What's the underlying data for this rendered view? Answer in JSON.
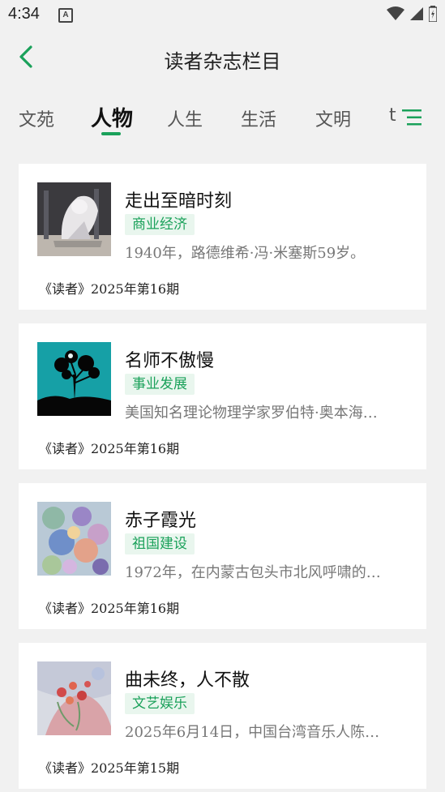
{
  "status_bar": {
    "time": "4:34"
  },
  "header": {
    "title": "读者杂志栏目"
  },
  "tabs": [
    {
      "label": "文苑",
      "active": false
    },
    {
      "label": "人物",
      "active": true
    },
    {
      "label": "人生",
      "active": false
    },
    {
      "label": "生活",
      "active": false
    },
    {
      "label": "文明",
      "active": false
    },
    {
      "label": "t",
      "active": false
    }
  ],
  "accent_color": "#1aa15a",
  "articles": [
    {
      "title": "走出至暗时刻",
      "tag": "商业经济",
      "desc": "1940年，路德维希·冯·米塞斯59岁。",
      "source": "《读者》2025年第16期"
    },
    {
      "title": "名师不傲慢",
      "tag": "事业发展",
      "desc": "美国知名理论物理学家罗伯特·奥本海…",
      "source": "《读者》2025年第16期"
    },
    {
      "title": "赤子霞光",
      "tag": "祖国建设",
      "desc": "1972年，在内蒙古包头市北风呼啸的…",
      "source": "《读者》2025年第16期"
    },
    {
      "title": "曲未终，人不散",
      "tag": "文艺娱乐",
      "desc": "2025年6月14日，中国台湾音乐人陈…",
      "source": "《读者》2025年第15期"
    }
  ]
}
